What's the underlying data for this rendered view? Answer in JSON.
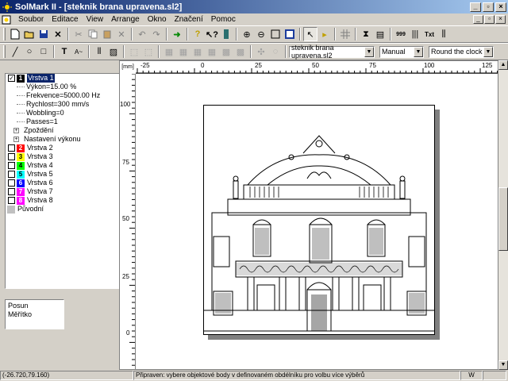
{
  "window": {
    "title": "SolMark II - [steknik brana upravena.sl2]"
  },
  "menu": [
    "Soubor",
    "Editace",
    "View",
    "Arrange",
    "Okno",
    "Značení",
    "Pomoc"
  ],
  "toolbar2": {
    "file_combo": "steknik brana upravena.sl2",
    "mode_combo": "Manual",
    "direction_combo": "Round the clock"
  },
  "ruler": {
    "unit": "[mm]",
    "h_ticks": [
      "-25",
      "0",
      "25",
      "50",
      "75",
      "100",
      "125"
    ],
    "v_ticks": [
      "100",
      "75",
      "50",
      "25",
      "0"
    ]
  },
  "layers": [
    {
      "num": "1",
      "label": "Vrstva 1",
      "color": "#000000",
      "checked": true,
      "selected": true
    },
    {
      "num": "2",
      "label": "Vrstva 2",
      "color": "#ff0000",
      "checked": false
    },
    {
      "num": "3",
      "label": "Vrstva 3",
      "color": "#ffff00",
      "checked": false
    },
    {
      "num": "4",
      "label": "Vrstva 4",
      "color": "#00ff00",
      "checked": false
    },
    {
      "num": "5",
      "label": "Vrstva 5",
      "color": "#00ffff",
      "checked": false
    },
    {
      "num": "6",
      "label": "Vrstva 6",
      "color": "#0000ff",
      "checked": false
    },
    {
      "num": "7",
      "label": "Vrstva 7",
      "color": "#ff00ff",
      "checked": false
    },
    {
      "num": "8",
      "label": "Vrstva 8",
      "color": "#ff00ff",
      "checked": false
    }
  ],
  "layer1_props": [
    "Výkon=15.00 %",
    "Frekvence=5000.00 Hz",
    "Rychlost=300 mm/s",
    "Wobbling=0",
    "Passes=1",
    "Zpoždění",
    "Nastavení výkonu"
  ],
  "original_label": "Původní",
  "info_panel": [
    "Posun",
    "Měřítko"
  ],
  "status": {
    "coords": "(-26.720,79.160)",
    "message": "Připraven: vybere objektové body v definovaném obdélníku pro volbu více výběrů",
    "indicator": "W"
  }
}
